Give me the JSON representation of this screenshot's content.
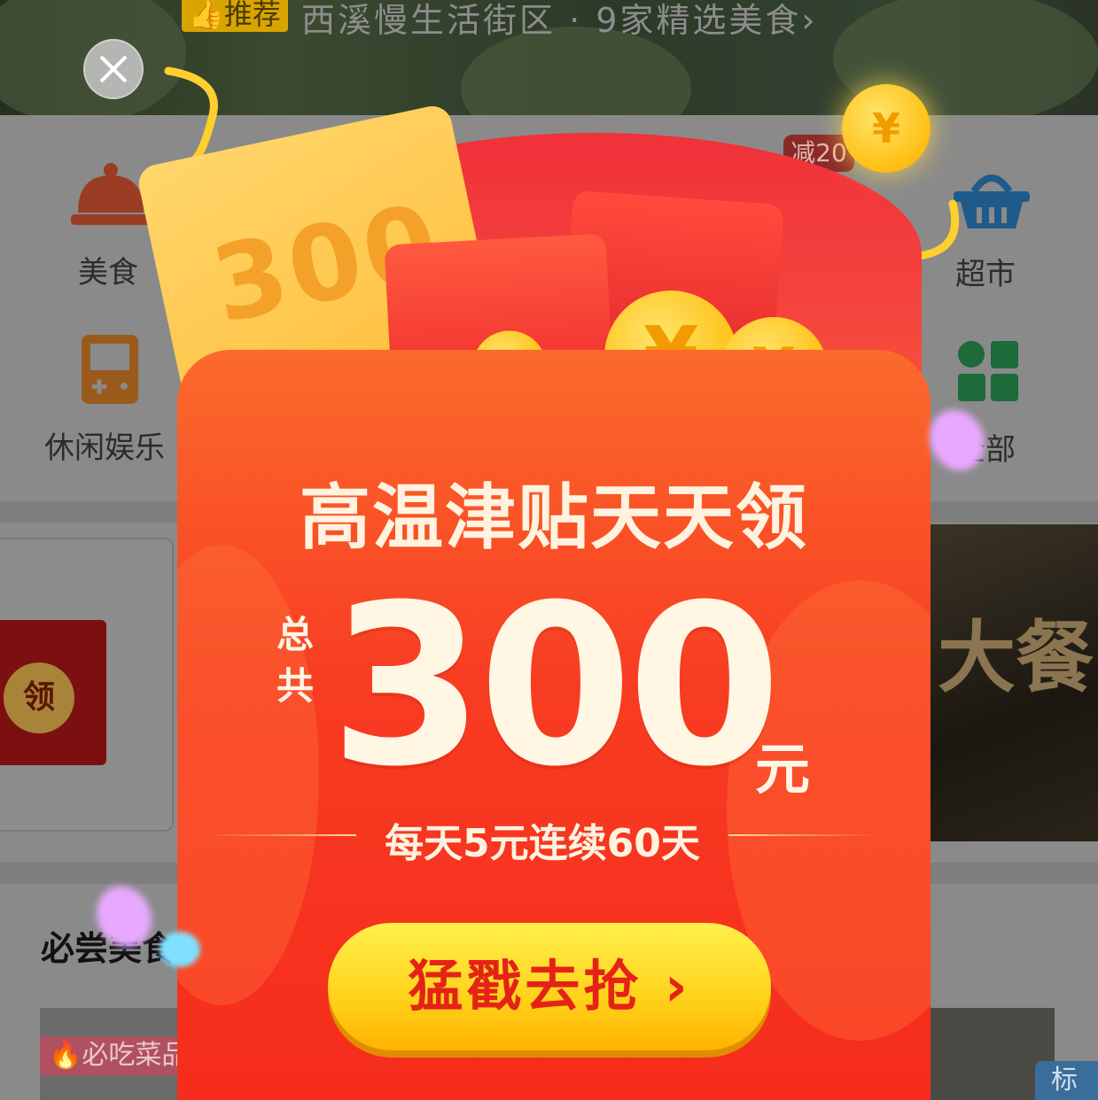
{
  "banner": {
    "tag": "👍推荐",
    "title": "西溪慢生活街区 · 9家精选美食›"
  },
  "categories": [
    {
      "label": "美食",
      "icon": "dish-cover-icon",
      "color": "#9a3d24"
    },
    {
      "label": "超市",
      "icon": "basket-icon",
      "color": "#1f5b8a"
    },
    {
      "label": "休闲娱乐",
      "icon": "gameboy-icon",
      "color": "#9a5a1c"
    },
    {
      "label": "全部",
      "icon": "grid-icon",
      "color": "#1d6a3a"
    }
  ],
  "discount_badge": "减20",
  "coupon": {
    "claim": "领"
  },
  "promo_right": {
    "text": "大餐"
  },
  "section": {
    "title": "必尝美食"
  },
  "food_card": {
    "badge": "必吃菜品"
  },
  "tag_right": "标",
  "popup": {
    "calendar_number": "300",
    "coin_symbol": "¥",
    "headline": "高温津贴天天领",
    "total_label": "总共",
    "amount": "300",
    "unit": "元",
    "subline": "每天5元连续60天",
    "cta": "猛戳去抢 ›",
    "close": "×",
    "colors": {
      "envelope": "#f83c22",
      "cta": "#ffd11a",
      "cta_text": "#e42316",
      "coin": "#ffc21a"
    }
  }
}
